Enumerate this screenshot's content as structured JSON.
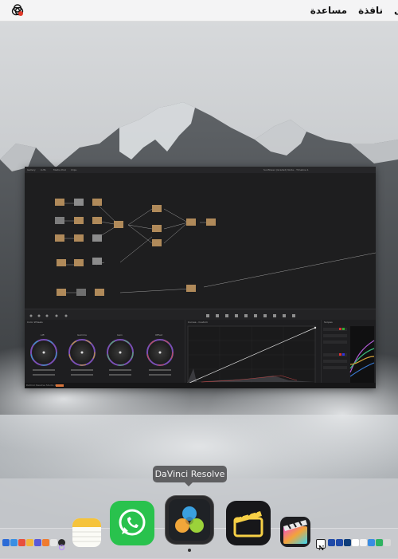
{
  "menubar": {
    "items": [
      "مساعدة",
      "نافذة",
      "ى"
    ]
  },
  "app_window": {
    "title": "DaVinci Resolve",
    "tabs": [
      "Gallery",
      "LUTs",
      "Media Pool",
      "Clips"
    ],
    "viewer_title": "Sunflower (Graded) Node - Timeline 1",
    "panels": [
      "Color Wheels",
      "Curves - Custom",
      "Scopes"
    ],
    "wheel_labels": [
      "Lift",
      "Gamma",
      "Gain",
      "Offset"
    ],
    "status": "DaVinci Resolve Studio 18"
  },
  "tooltip": {
    "text": "DaVinci Resolve"
  },
  "dock": {
    "apps": [
      "Notes",
      "WhatsApp",
      "DaVinci Resolve",
      "Claquette",
      "Final Cut Pro",
      "Notion"
    ]
  }
}
